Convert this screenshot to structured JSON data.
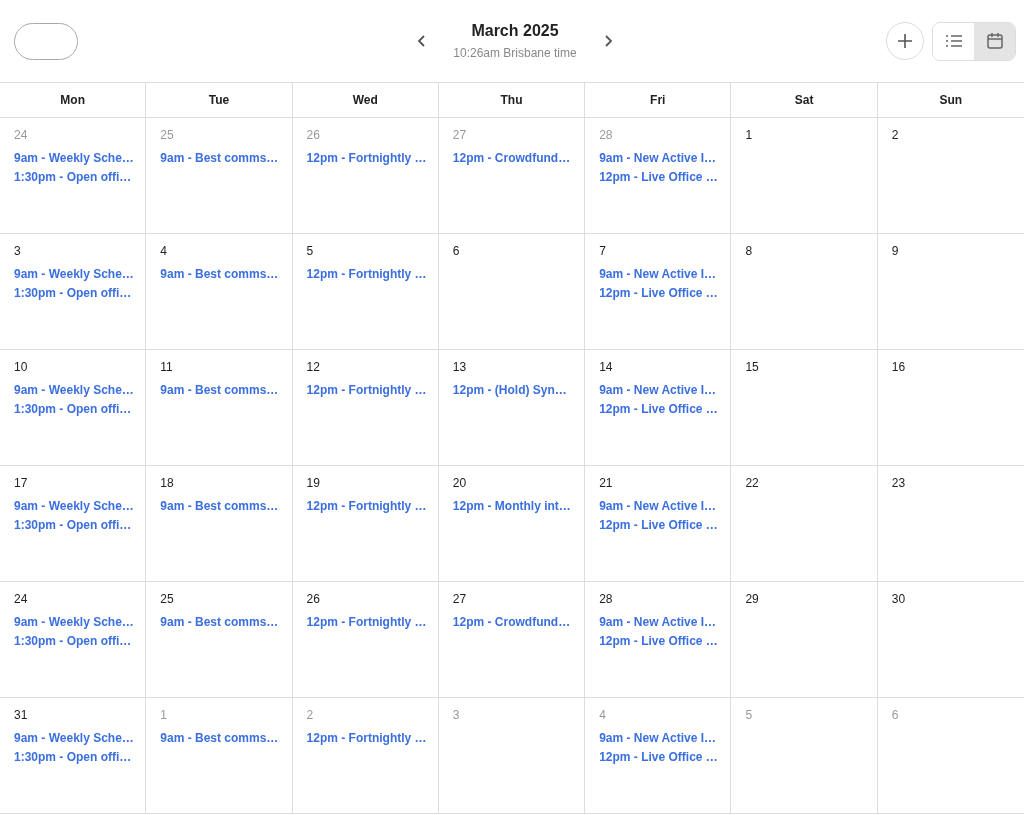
{
  "header": {
    "title": "March 2025",
    "subtitle": "10:26am Brisbane time",
    "views": [
      {
        "kind": "list",
        "selected": false
      },
      {
        "kind": "calendar",
        "selected": true
      }
    ]
  },
  "weekdays": [
    "Mon",
    "Tue",
    "Wed",
    "Thu",
    "Fri",
    "Sat",
    "Sun"
  ],
  "weeks": [
    [
      {
        "day": "24",
        "outside": true,
        "events": [
          "9am - Weekly Sche…",
          "1:30pm - Open offi…"
        ]
      },
      {
        "day": "25",
        "outside": true,
        "events": [
          "9am - Best comms…"
        ]
      },
      {
        "day": "26",
        "outside": true,
        "events": [
          "12pm - Fortnightly …"
        ]
      },
      {
        "day": "27",
        "outside": true,
        "events": [
          "12pm - Crowdfund…"
        ]
      },
      {
        "day": "28",
        "outside": true,
        "events": [
          "9am - New Active I…",
          "12pm - Live Office …"
        ]
      },
      {
        "day": "1",
        "outside": false
      },
      {
        "day": "2",
        "outside": false
      }
    ],
    [
      {
        "day": "3",
        "outside": false,
        "events": [
          "9am - Weekly Sche…",
          "1:30pm - Open offi…"
        ]
      },
      {
        "day": "4",
        "outside": false,
        "events": [
          "9am - Best comms…"
        ]
      },
      {
        "day": "5",
        "outside": false,
        "events": [
          "12pm - Fortnightly …"
        ]
      },
      {
        "day": "6",
        "outside": false
      },
      {
        "day": "7",
        "outside": false,
        "events": [
          "9am - New Active I…",
          "12pm - Live Office …"
        ]
      },
      {
        "day": "8",
        "outside": false
      },
      {
        "day": "9",
        "outside": false
      }
    ],
    [
      {
        "day": "10",
        "outside": false,
        "events": [
          "9am - Weekly Sche…",
          "1:30pm - Open offi…"
        ]
      },
      {
        "day": "11",
        "outside": false,
        "events": [
          "9am - Best comms…"
        ]
      },
      {
        "day": "12",
        "outside": false,
        "events": [
          "12pm - Fortnightly …"
        ]
      },
      {
        "day": "13",
        "outside": false,
        "events": [
          "12pm - (Hold) Syn…"
        ]
      },
      {
        "day": "14",
        "outside": false,
        "events": [
          "9am - New Active I…",
          "12pm - Live Office …"
        ]
      },
      {
        "day": "15",
        "outside": false
      },
      {
        "day": "16",
        "outside": false
      }
    ],
    [
      {
        "day": "17",
        "outside": false,
        "events": [
          "9am - Weekly Sche…",
          "1:30pm - Open offi…"
        ]
      },
      {
        "day": "18",
        "outside": false,
        "events": [
          "9am - Best comms…"
        ]
      },
      {
        "day": "19",
        "outside": false,
        "events": [
          "12pm - Fortnightly …"
        ]
      },
      {
        "day": "20",
        "outside": false,
        "events": [
          "12pm - Monthly int…"
        ]
      },
      {
        "day": "21",
        "outside": false,
        "events": [
          "9am - New Active I…",
          "12pm - Live Office …"
        ]
      },
      {
        "day": "22",
        "outside": false
      },
      {
        "day": "23",
        "outside": false
      }
    ],
    [
      {
        "day": "24",
        "outside": false,
        "events": [
          "9am - Weekly Sche…",
          "1:30pm - Open offi…"
        ]
      },
      {
        "day": "25",
        "outside": false,
        "events": [
          "9am - Best comms…"
        ]
      },
      {
        "day": "26",
        "outside": false,
        "events": [
          "12pm - Fortnightly …"
        ]
      },
      {
        "day": "27",
        "outside": false,
        "events": [
          "12pm - Crowdfund…"
        ]
      },
      {
        "day": "28",
        "outside": false,
        "events": [
          "9am - New Active I…",
          "12pm - Live Office …"
        ]
      },
      {
        "day": "29",
        "outside": false
      },
      {
        "day": "30",
        "outside": false
      }
    ],
    [
      {
        "day": "31",
        "outside": false,
        "events": [
          "9am - Weekly Sche…",
          "1:30pm - Open offi…"
        ]
      },
      {
        "day": "1",
        "outside": true,
        "events": [
          "9am - Best comms…"
        ]
      },
      {
        "day": "2",
        "outside": true,
        "events": [
          "12pm - Fortnightly …"
        ]
      },
      {
        "day": "3",
        "outside": true
      },
      {
        "day": "4",
        "outside": true,
        "events": [
          "9am - New Active I…",
          "12pm - Live Office …"
        ]
      },
      {
        "day": "5",
        "outside": true
      },
      {
        "day": "6",
        "outside": true
      }
    ]
  ]
}
